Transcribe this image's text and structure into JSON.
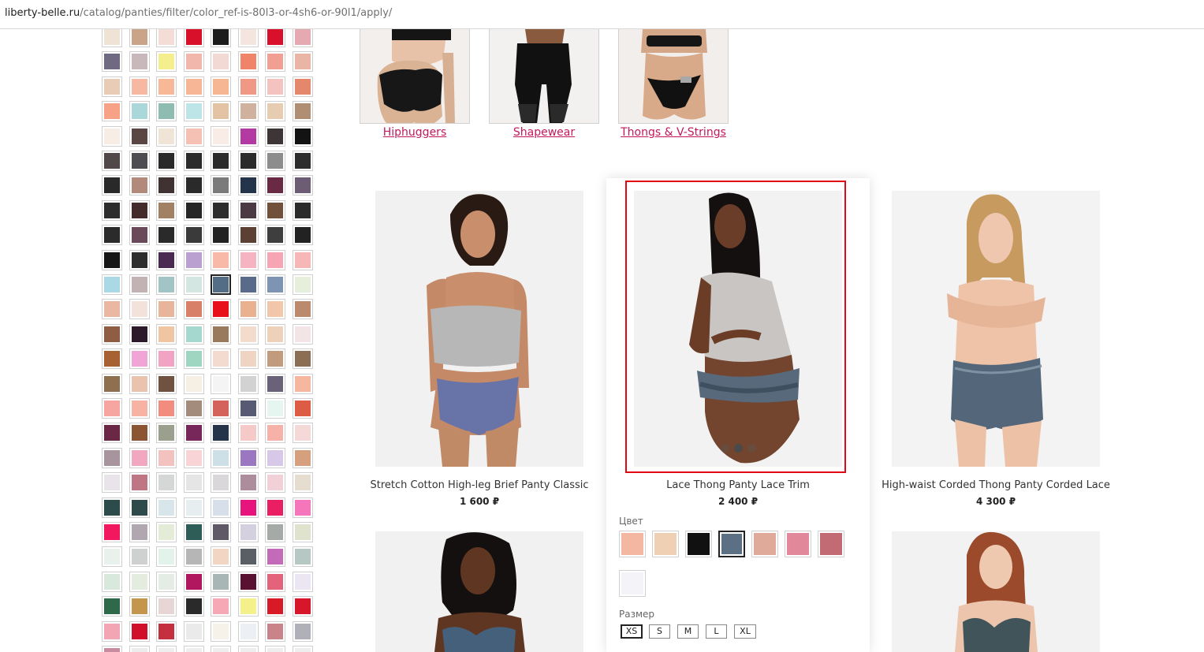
{
  "browser": {
    "url_host": "liberty-belle.ru",
    "url_path": "/catalog/panties/filter/color_ref-is-80l3-or-4sh6-or-90l1/apply/"
  },
  "filter_swatches": [
    [
      "#efe3d6",
      "#c9a489",
      "#f3ddd6",
      "#d8102a",
      "#1c1c1c",
      "#f4e6de",
      "#d8102a",
      "#e5a9b2"
    ],
    [
      "#6f6a82",
      "#c8b7bb",
      "#f4ef8c",
      "#f1b7ad",
      "#f3d9d3",
      "#f08468",
      "#f19e93",
      "#eab5a5"
    ],
    [
      "#e9ccb5",
      "#f6b8a1",
      "#f6b896",
      "#f7b696",
      "#f6b593",
      "#f19785",
      "#f4c3c0",
      "#e4876a"
    ],
    [
      "#f7a287",
      "#a9d7da",
      "#8fbcb0",
      "#bde4e6",
      "#e4c3a4",
      "#cfb19d",
      "#e6cdb2",
      "#b08e73"
    ],
    [
      "#f8ede4",
      "#5a4743",
      "#f0e4d6",
      "#f5c1b5",
      "#f9ece6",
      "#b33aa3",
      "#3e3636",
      "#131313"
    ],
    [
      "#504849",
      "#4d4c50",
      "#2a2a2a",
      "#2b2b2b",
      "#2b2b2b",
      "#2b2b2b",
      "#8d8d8d",
      "#2d2d2d"
    ],
    [
      "#292929",
      "#b28a7c",
      "#403232",
      "#2a2a2a",
      "#7b7b7b",
      "#24344a",
      "#6a2a44",
      "#6d5d74"
    ],
    [
      "#2d2d2d",
      "#442c2c",
      "#a28063",
      "#262626",
      "#2d2d2d",
      "#4b3a43",
      "#71513a",
      "#2b2b2b"
    ],
    [
      "#2b2b2b",
      "#6a4a5a",
      "#2a2a2a",
      "#3a3a3a",
      "#222222",
      "#5c4034",
      "#3e3e3e",
      "#222222"
    ],
    [
      "#161616",
      "#2d2d2d",
      "#4a2a52",
      "#b9a0d0",
      "#f8b9a8",
      "#f5b4bf",
      "#f7a4b4",
      "#f8b7b7"
    ],
    [
      "#abd8e5",
      "#c3b2b4",
      "#a3c4c7",
      "#d3e6e2",
      "#536d87",
      "#5a6a8a",
      "#7d94b2",
      "#e5efdc"
    ],
    [
      "#eab8a2",
      "#f2e2da",
      "#e8b59a",
      "#d98068",
      "#e8111b",
      "#eab190",
      "#f2c7a9",
      "#bb8a6d"
    ],
    [
      "#8f5d44",
      "#2c1a2b",
      "#f0c6a2",
      "#a5d9d0",
      "#9a7a5c",
      "#f3dccb",
      "#edd1b8",
      "#f3e4e6"
    ],
    [
      "#a66233",
      "#f1a5d6",
      "#f2a3c4",
      "#9fd6c2",
      "#f3dccf",
      "#efd4c3",
      "#c19b7b",
      "#8c6e55"
    ],
    [
      "#8e6f4f",
      "#e9c3ad",
      "#6f5340",
      "#f6f0e4",
      "#f4f4f4",
      "#d2d2d2",
      "#696278",
      "#f6b79e"
    ],
    [
      "#f7a5a1",
      "#f6b3a3",
      "#f28c7f",
      "#a48c7c",
      "#d4645b",
      "#565a72",
      "#e5f5ef",
      "#dc5c44"
    ],
    [
      "#6b2846",
      "#8b5433",
      "#9aa08d",
      "#78275a",
      "#26344a",
      "#f5c9c8",
      "#f6b2a8",
      "#f5d8d8"
    ],
    [
      "#a8949d",
      "#f1a7c0",
      "#f3c2bf",
      "#f8d4d6",
      "#cde0e8",
      "#9a77c0",
      "#d8c8e8",
      "#d6a07e"
    ],
    [
      "#e8e4ea",
      "#c07585",
      "#d4d7d6",
      "#e5e5e5",
      "#d9d7d9",
      "#ad8c9b",
      "#f2d0d8",
      "#e5ddd0"
    ],
    [
      "#2d4b4a",
      "#2e4a4a",
      "#d8e5ea",
      "#e6eef0",
      "#d7e0ea",
      "#e8147e",
      "#e91e63",
      "#f576ba"
    ],
    [
      "#f2185f",
      "#b0a7b0",
      "#e4ecd8",
      "#2e5c56",
      "#5f5867",
      "#d5d0e0",
      "#a6aaa6",
      "#dfe2cd"
    ],
    [
      "#e8f1ec",
      "#cfd0d0",
      "#e1f3ea",
      "#b6b6b6",
      "#f3d5c3",
      "#5a5f65",
      "#c36bb8",
      "#b7c7c3"
    ],
    [
      "#d8e8dd",
      "#e4ece0",
      "#e5ece5",
      "#b0175e",
      "#a8b6b6",
      "#5a1030",
      "#e3637b",
      "#ece6f2"
    ],
    [
      "#2e6a4a",
      "#c4964d",
      "#e8d5d5",
      "#2a2a2a",
      "#f6a9b4",
      "#f4f08a",
      "#d81a26",
      "#d8162a"
    ],
    [
      "#f2a5b2",
      "#d0102a",
      "#c43040",
      "#eaeaea",
      "#f6f2ea",
      "#ecf0f5",
      "#c9848a",
      "#b0b0b8"
    ],
    [
      "#c88ca0",
      "#ececec",
      "#eeeeee",
      "#eeeeee",
      "#eeeeee",
      "#eeeeee",
      "#eeeeee",
      "#eeeeee"
    ]
  ],
  "categories": [
    {
      "label": "Hiphuggers"
    },
    {
      "label": "Shapewear"
    },
    {
      "label": "Thongs & V-Strings"
    }
  ],
  "products": [
    {
      "name": "Stretch Cotton High-leg Brief Panty Classic",
      "price": "1 600 ₽"
    },
    {
      "name": "Lace Thong Panty Lace Trim",
      "price": "2 400 ₽"
    },
    {
      "name": "High-waist Corded Thong Panty Corded Lace",
      "price": "4 300 ₽"
    }
  ],
  "quick_options": {
    "color_label": "Цвет",
    "colors": [
      {
        "name": "floral",
        "hex": "#f4b8a2"
      },
      {
        "name": "nude",
        "hex": "#efd0b4"
      },
      {
        "name": "black",
        "hex": "#111111"
      },
      {
        "name": "slate",
        "hex": "#5b7085"
      },
      {
        "name": "blush-lace",
        "hex": "#dfaa9a"
      },
      {
        "name": "pink-floral",
        "hex": "#e1889a"
      },
      {
        "name": "rose",
        "hex": "#c26b74"
      },
      {
        "name": "white",
        "hex": "#f4f4f8"
      }
    ],
    "size_label": "Размер",
    "sizes": [
      "XS",
      "S",
      "M",
      "L",
      "XL"
    ]
  },
  "colors": {
    "accent_link": "#c2185b",
    "highlight": "#e30613"
  }
}
